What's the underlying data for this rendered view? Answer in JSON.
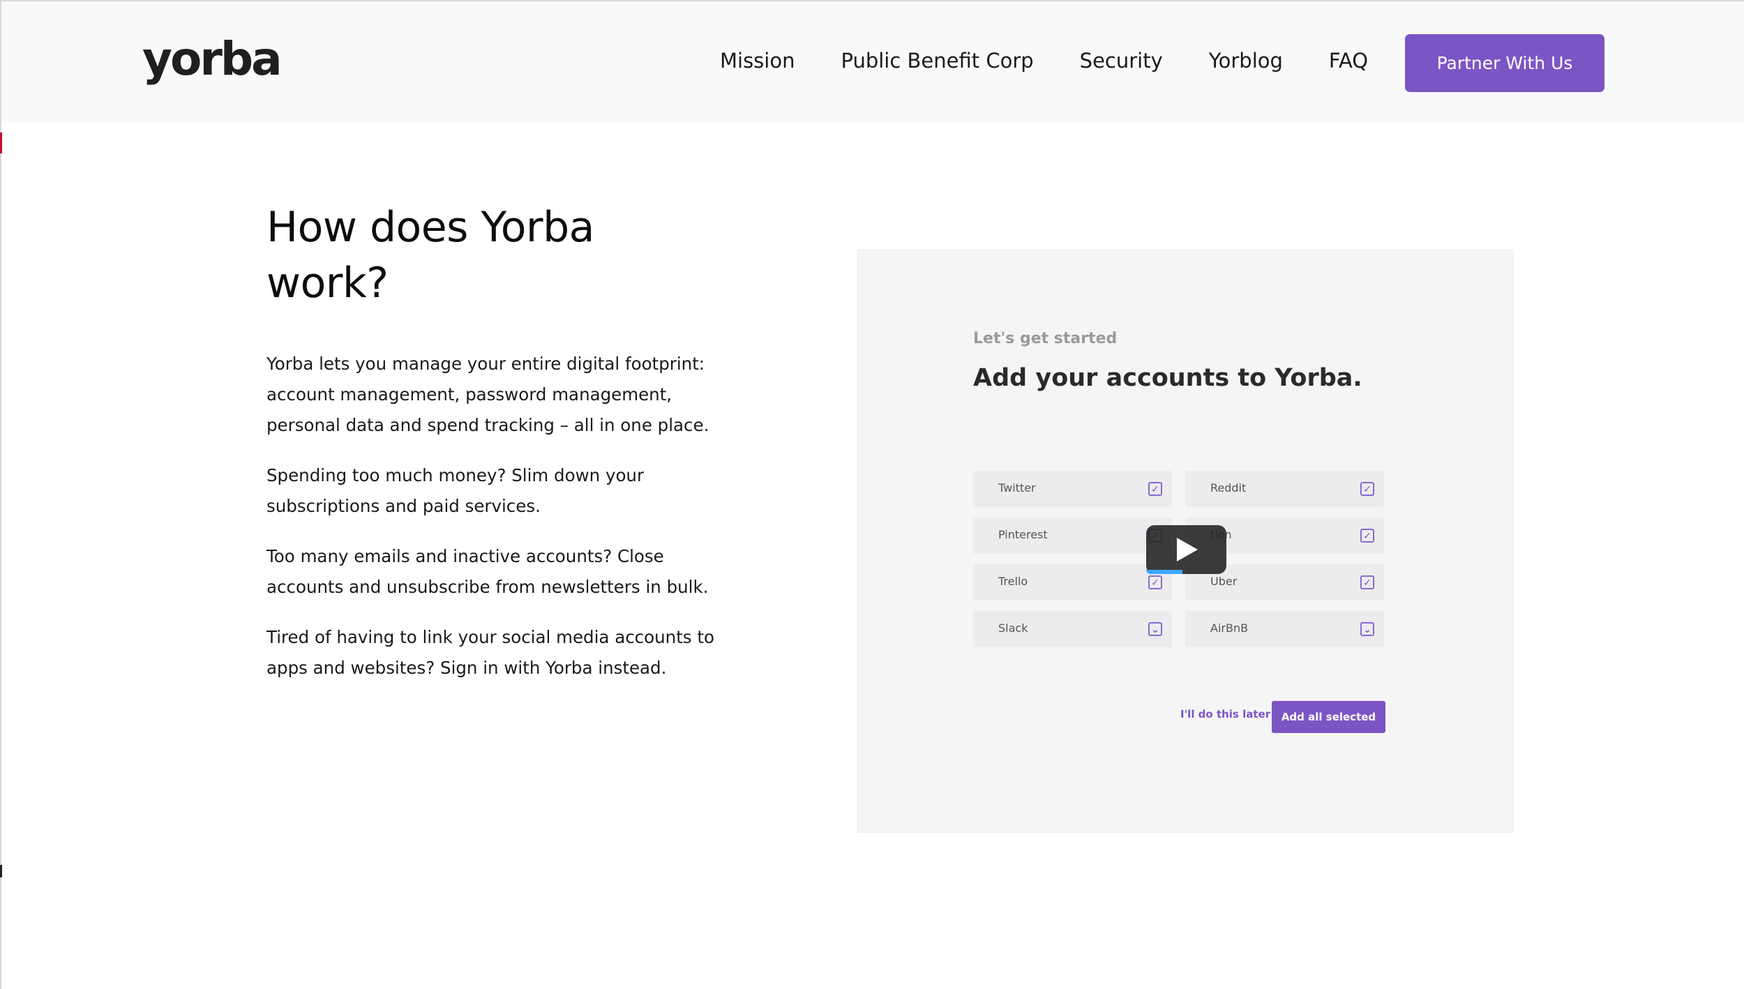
{
  "header": {
    "logo": "yorba",
    "nav": [
      "Mission",
      "Public Benefit Corp",
      "Security",
      "Yorblog",
      "FAQ"
    ],
    "cta_label": "Partner With Us",
    "accent_color": "#7c55c5"
  },
  "main": {
    "title_line1": "How does Yorba",
    "title_line2": "work?",
    "paragraphs": [
      [
        "Yorba lets you manage your entire digital footprint:",
        "account management, password management,",
        "personal data and spend tracking – all in one place."
      ],
      [
        "Spending too much money? Slim down your",
        "subscriptions and paid services."
      ],
      [
        "Too many emails and inactive accounts? Close",
        "accounts and unsubscribe from newsletters in bulk."
      ],
      [
        "Tired of having to link your social media accounts to",
        "apps and websites? Sign in with Yorba instead."
      ]
    ]
  },
  "video": {
    "kicker": "Let's get started",
    "title": "Add your accounts to Yorba.",
    "accounts": [
      "Twitter",
      "Reddit",
      "Pinterest",
      "tion",
      "Trello",
      "Uber",
      "Slack",
      "AirBnB"
    ],
    "later_label": "I'll do this later",
    "add_label": "Add all selected",
    "play_icon": "play-icon",
    "progress_fraction": 0.45
  }
}
